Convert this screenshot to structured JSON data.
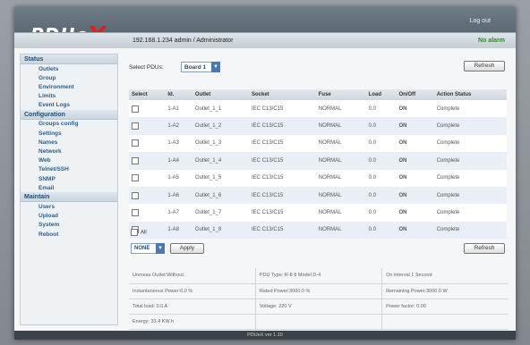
{
  "header": {
    "logo_main": "PDUe",
    "logo_x": "X",
    "logout": "Log out",
    "ip_user": "192.168.1.234   admin / Administrator",
    "alarm": "No alarm"
  },
  "sidebar": {
    "sections": [
      {
        "title": "Status",
        "items": [
          "Outlets",
          "Group",
          "Environment",
          "Limits",
          "Event Logs"
        ]
      },
      {
        "title": "Configuration",
        "items": [
          "Groups config",
          "Settings",
          "Names",
          "Network",
          "Web",
          "Telnet/SSH",
          "SNMP",
          "Email"
        ]
      },
      {
        "title": "Maintain",
        "items": [
          "Users",
          "Upload",
          "System",
          "Reboot"
        ]
      }
    ]
  },
  "main": {
    "select_label": "Select PDUs:",
    "select_value": "Board 1",
    "refresh_label": "Refresh",
    "columns": [
      "Select",
      "Id.",
      "Outlet",
      "Socket",
      "Fuse",
      "Load",
      "On/Off",
      "Action Status"
    ],
    "rows": [
      [
        "1-A1",
        "Outlet_1_1",
        "IEC C13/C15",
        "NORMAL",
        "0.0",
        "ON",
        "Complete"
      ],
      [
        "1-A2",
        "Outlet_1_2",
        "IEC C13/C15",
        "NORMAL",
        "0.0",
        "ON",
        "Complete"
      ],
      [
        "1-A3",
        "Outlet_1_3",
        "IEC C13/C15",
        "NORMAL",
        "0.0",
        "ON",
        "Complete"
      ],
      [
        "1-A4",
        "Outlet_1_4",
        "IEC C13/C15",
        "NORMAL",
        "0.0",
        "ON",
        "Complete"
      ],
      [
        "1-A5",
        "Outlet_1_5",
        "IEC C13/C15",
        "NORMAL",
        "0.0",
        "ON",
        "Complete"
      ],
      [
        "1-A6",
        "Outlet_1_6",
        "IEC C13/C15",
        "NORMAL",
        "0.0",
        "ON",
        "Complete"
      ],
      [
        "1-A7",
        "Outlet_1_7",
        "IEC C13/C15",
        "NORMAL",
        "0.0",
        "ON",
        "Complete"
      ],
      [
        "1-A8",
        "Outlet_1_8",
        "IEC C13/C15",
        "NORMAL",
        "0.0",
        "ON",
        "Complete"
      ]
    ],
    "all_label": "All",
    "action_value": "NONE",
    "apply_label": "Apply"
  },
  "info": {
    "cells": [
      [
        "Unmeas Outlet:Without",
        "PDU Type: R-8 8 Model D-4",
        "On interval 1 Second"
      ],
      [
        "Instantaneous Power:0.0 %",
        "Rated Power:3000.0 %",
        "Remaining Power:3000.0 W"
      ],
      [
        "Total load: 0.0 A",
        "Voltage: 220 V",
        "Power factor: 0.00"
      ],
      [
        "Energy: 33.4 KW.h",
        "",
        ""
      ]
    ]
  },
  "footer": {
    "text": "PDUeX ver 1.19"
  },
  "colors": {
    "accent": "#2d5f8f",
    "on": "#2a9a2a",
    "logo_x": "#e02020",
    "alarm": "#2a8a2a"
  }
}
